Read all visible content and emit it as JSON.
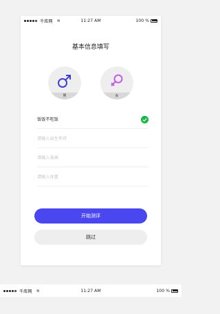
{
  "status": {
    "carrier": "千库网",
    "time": "11:27 AM",
    "battery": "100 %"
  },
  "page": {
    "title": "基本信息填写"
  },
  "gender": {
    "male_label": "男",
    "female_label": "女"
  },
  "diet": {
    "label": "饭饭不吃饭"
  },
  "inputs": {
    "birthday_placeholder": "请输入出生年月",
    "height_placeholder": "请输入身高",
    "weight_placeholder": "请输入体重"
  },
  "buttons": {
    "start": "开始测评",
    "skip": "跳过"
  },
  "colors": {
    "primary": "#4b47f0",
    "male_symbol": "#3e3bd6",
    "female_symbol": "#c25be8",
    "check": "#19b84a"
  },
  "icons": {
    "male": "male-symbol-icon",
    "female": "female-symbol-icon",
    "check": "check-circle-icon",
    "wifi": "wifi-icon",
    "battery": "battery-icon"
  }
}
